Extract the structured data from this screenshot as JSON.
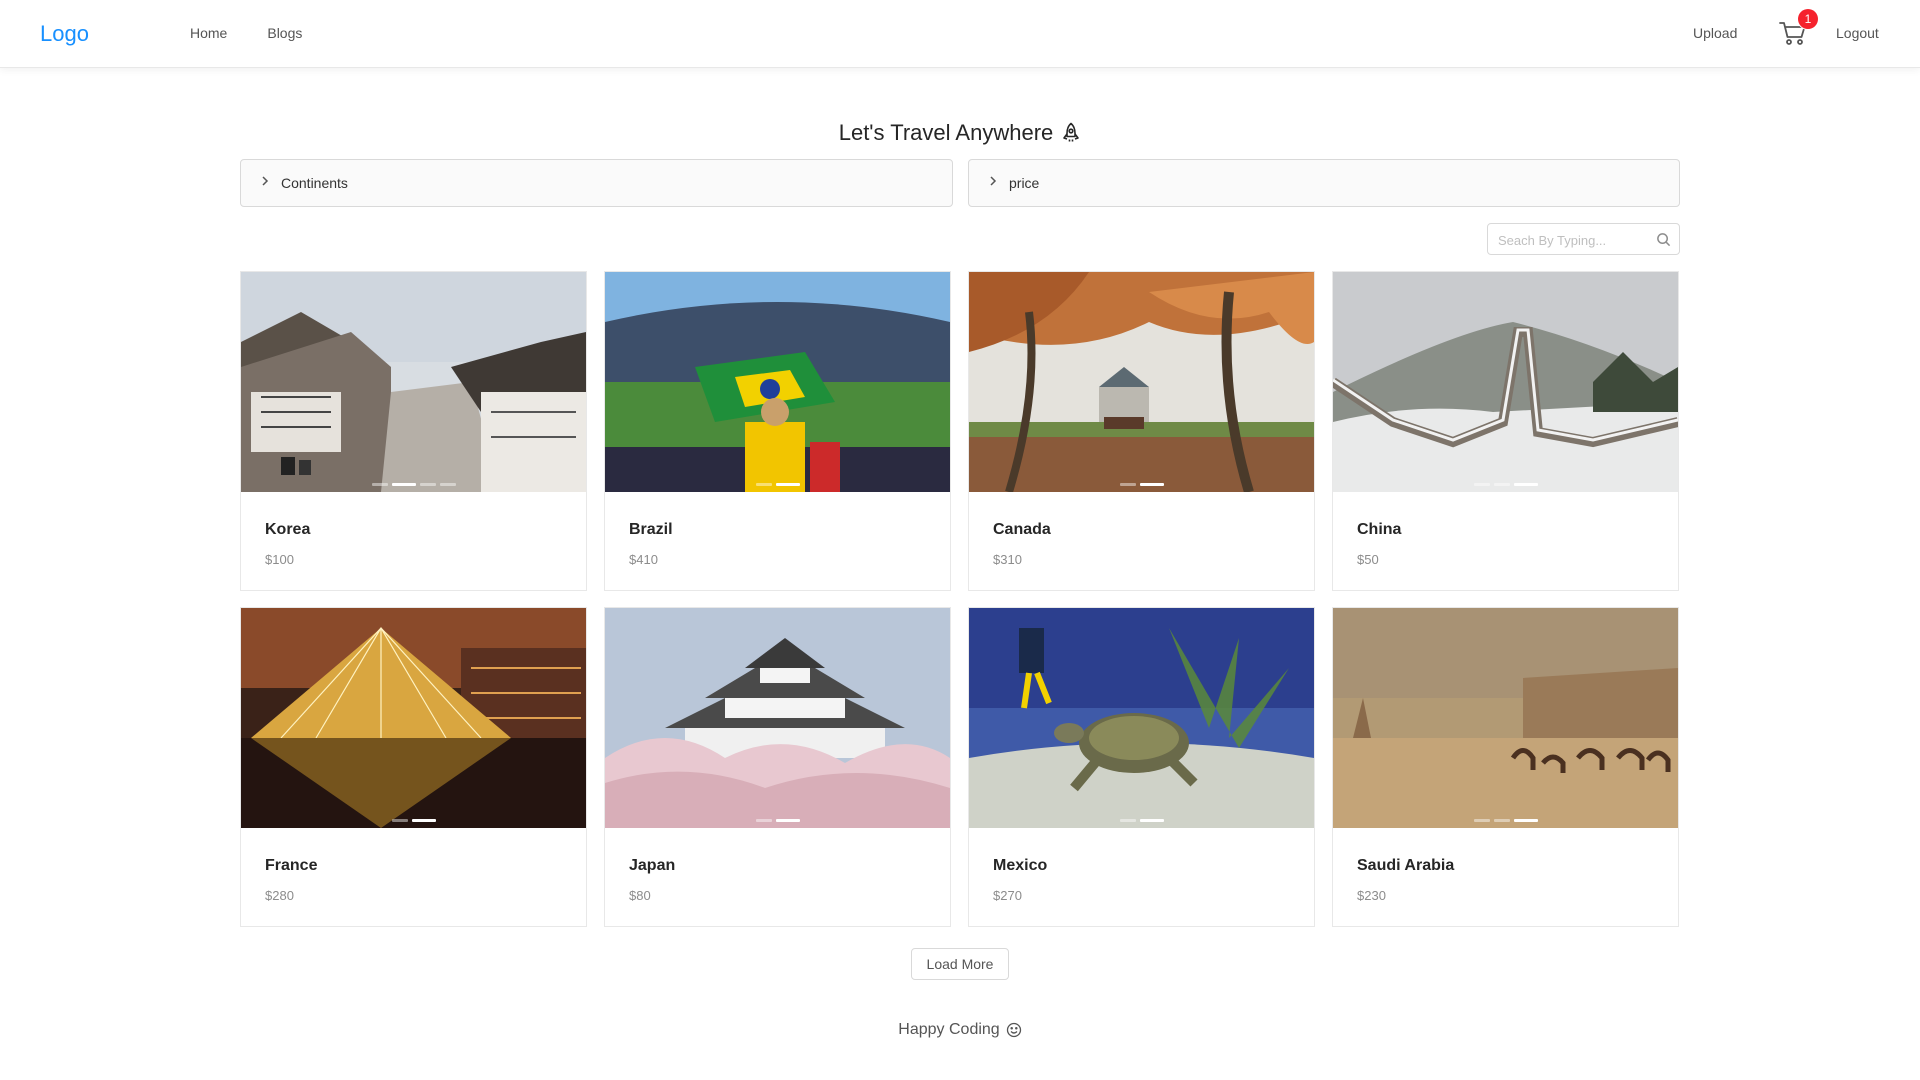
{
  "navbar": {
    "logo": "Logo",
    "links": [
      "Home",
      "Blogs"
    ],
    "upload": "Upload",
    "cart_icon": "shopping-cart-icon",
    "cart_badge": "1",
    "logout": "Logout",
    "accent_color": "#1890ff",
    "badge_color": "#f5222d"
  },
  "title": {
    "text": "Let's Travel Anywhere",
    "icon": "rocket-icon"
  },
  "filters": [
    {
      "label": "Continents",
      "icon": "chevron-right-icon"
    },
    {
      "label": "price",
      "icon": "chevron-right-icon"
    }
  ],
  "search": {
    "placeholder": "Seach By Typing...",
    "value": "",
    "icon": "search-icon"
  },
  "products": [
    {
      "title": "Korea",
      "price": "$100",
      "slides": 4,
      "active_slide": 2,
      "image": "korean-hanok-village"
    },
    {
      "title": "Brazil",
      "price": "$410",
      "slides": 2,
      "active_slide": 2,
      "image": "brazil-football-stadium"
    },
    {
      "title": "Canada",
      "price": "$310",
      "slides": 2,
      "active_slide": 2,
      "image": "autumn-trees-chateau"
    },
    {
      "title": "China",
      "price": "$50",
      "slides": 3,
      "active_slide": 3,
      "image": "great-wall-snow"
    },
    {
      "title": "France",
      "price": "$280",
      "slides": 2,
      "active_slide": 2,
      "image": "louvre-pyramid-night"
    },
    {
      "title": "Japan",
      "price": "$80",
      "slides": 2,
      "active_slide": 2,
      "image": "himeji-castle-blossoms"
    },
    {
      "title": "Mexico",
      "price": "$270",
      "slides": 2,
      "active_slide": 2,
      "image": "sea-turtle-divers"
    },
    {
      "title": "Saudi Arabia",
      "price": "$230",
      "slides": 3,
      "active_slide": 3,
      "image": "desert-camels"
    }
  ],
  "load_more": "Load More",
  "footer": {
    "text": "Happy Coding",
    "icon": "smile-icon"
  }
}
